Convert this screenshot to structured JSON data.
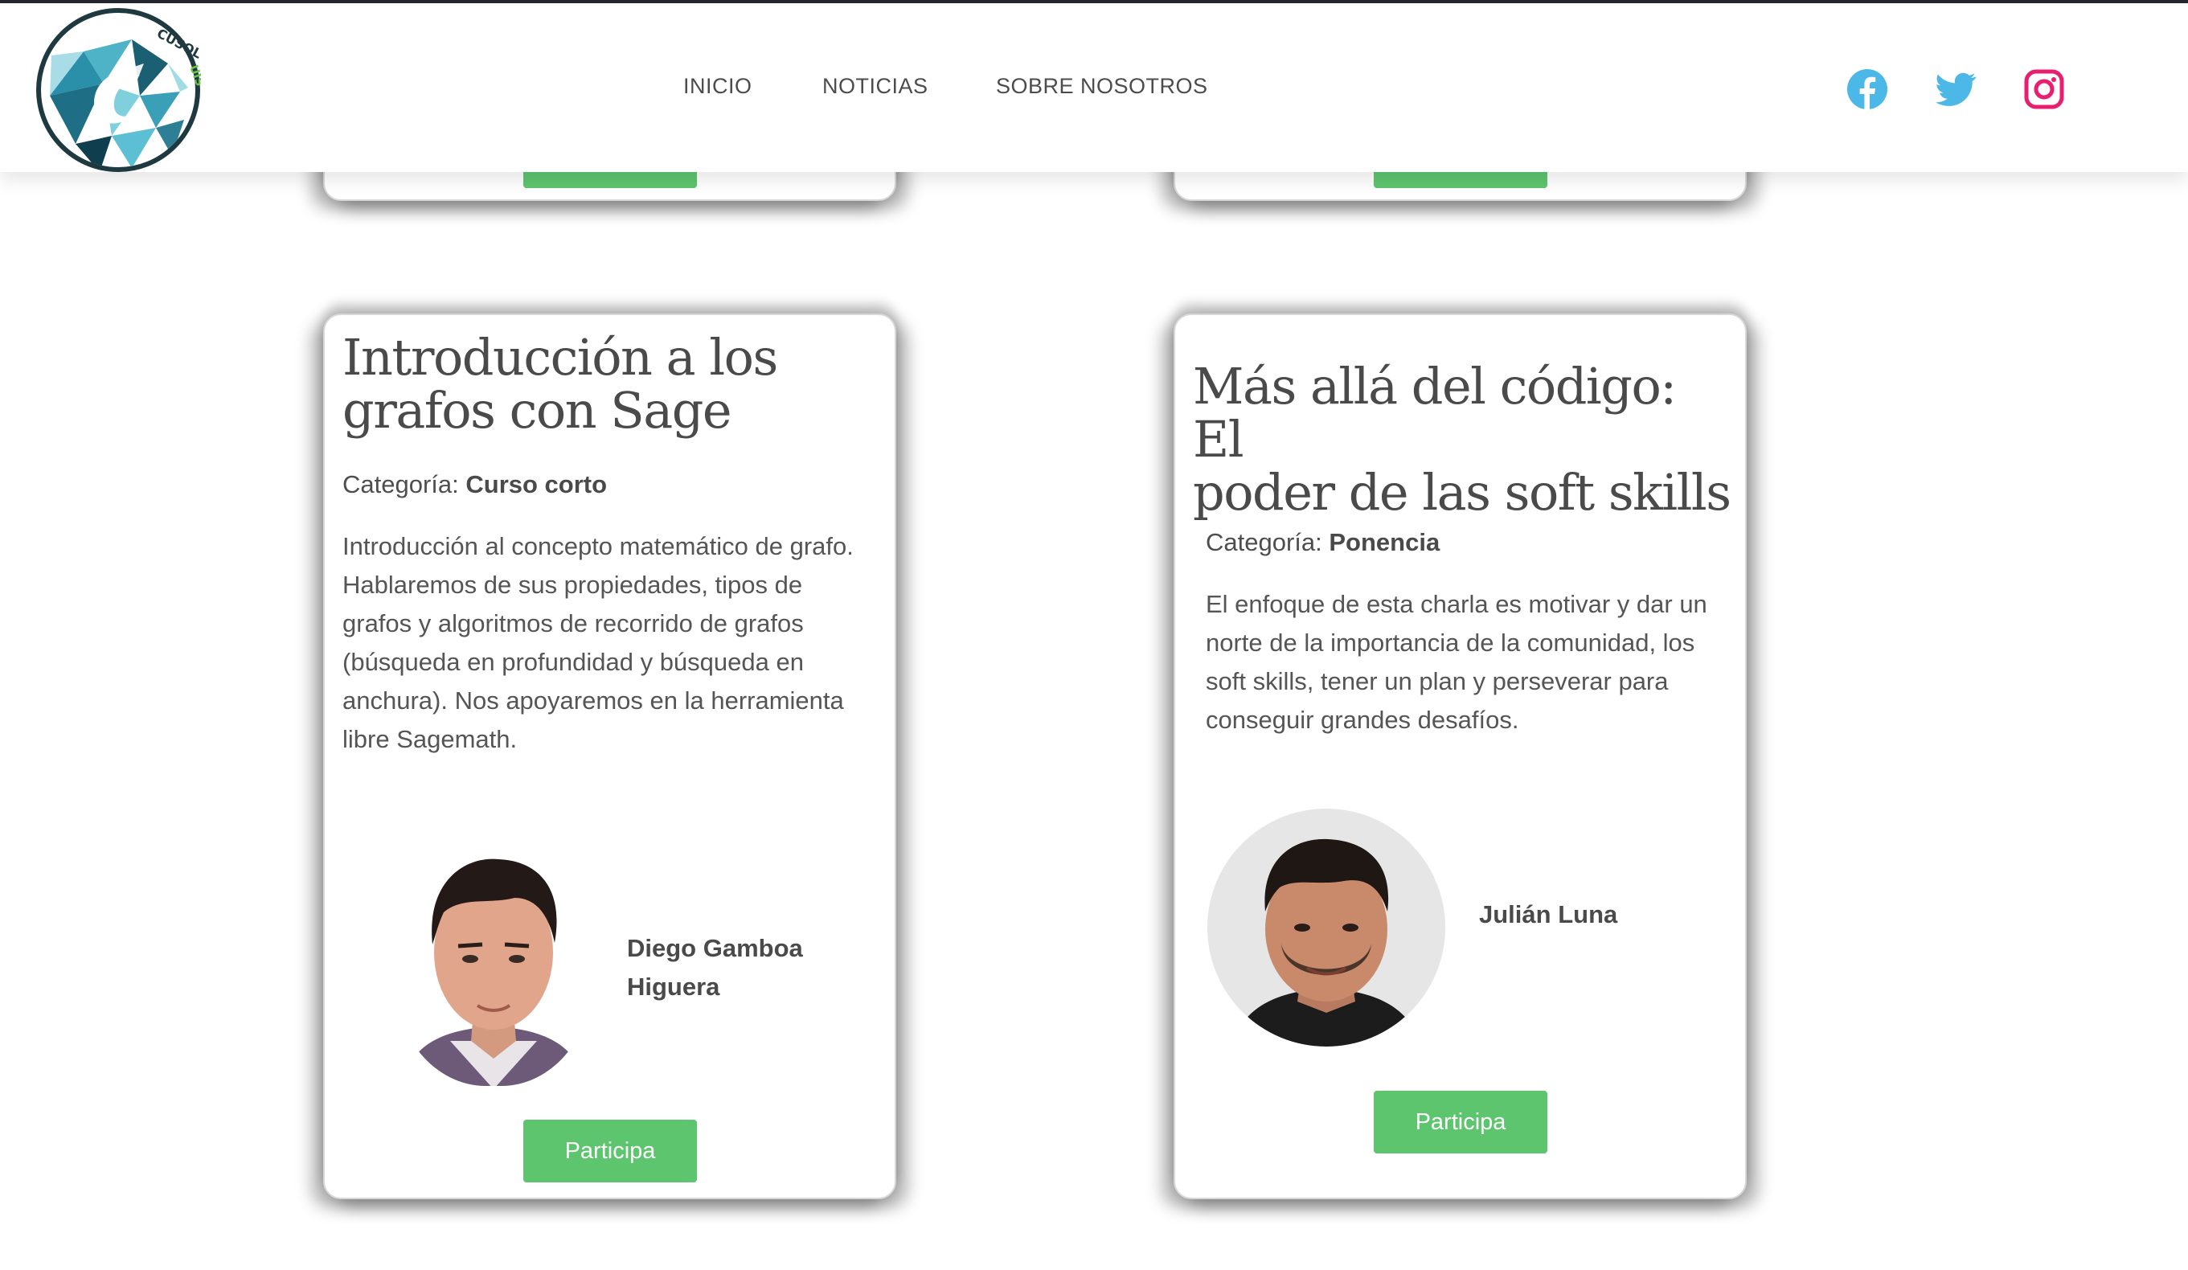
{
  "header": {
    "logo_text": "CUSOL UIS",
    "nav": [
      "INICIO",
      "NOTICIAS",
      "SOBRE NOSOTROS"
    ],
    "social": {
      "facebook_icon": "facebook-icon",
      "twitter_icon": "twitter-icon",
      "instagram_icon": "instagram-icon"
    }
  },
  "colors": {
    "facebook": "#4bb8e8",
    "twitter": "#4bb8e8",
    "instagram": "#e81e6e",
    "button": "#5ec56f",
    "title_text": "#4a4a4a"
  },
  "cards": [
    {
      "title_line1": "Introducción a los",
      "title_line2": "grafos con Sage",
      "category_label": "Categoría: ",
      "category_value": "Curso corto",
      "description": [
        "Introducción al concepto matemático de grafo.",
        "Hablaremos de sus propiedades, tipos de",
        "grafos y algoritmos de recorrido de grafos",
        "(búsqueda en profundidad y búsqueda en",
        "anchura). Nos apoyaremos en la herramienta",
        "libre Sagemath."
      ],
      "speaker_line1": "Diego Gamboa",
      "speaker_line2": "Higuera",
      "button": "Participa"
    },
    {
      "title_line1": "Más allá del código: El",
      "title_line2": "poder de las soft skills",
      "category_label": "Categoría: ",
      "category_value": "Ponencia",
      "description": [
        "El enfoque de esta charla es motivar y dar un",
        "norte de la importancia de la comunidad, los",
        "soft skills, tener un plan y perseverar para",
        "conseguir grandes desafíos."
      ],
      "speaker_line1": "Julián Luna",
      "button": "Participa"
    }
  ]
}
